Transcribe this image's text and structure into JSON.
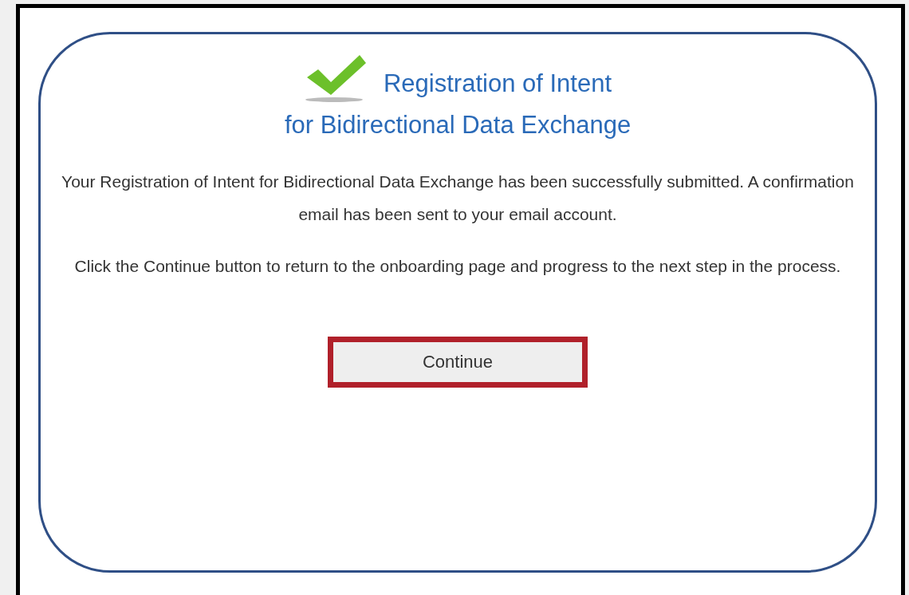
{
  "dialog": {
    "title_lines": [
      "Registration of Intent",
      "for Bidirectional Data Exchange"
    ],
    "paragraphs": [
      "Your Registration of Intent for Bidirectional Data Exchange has been successfully submitted. A confirmation email has been sent to your email account.",
      "Click the Continue button to return to the onboarding page and progress to the next step in the process."
    ],
    "button": {
      "label": "Continue",
      "highlighted": true
    }
  }
}
